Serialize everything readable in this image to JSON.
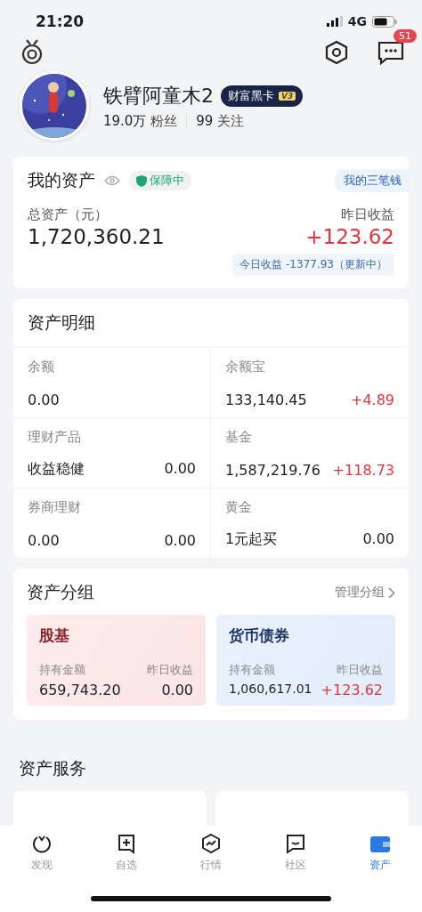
{
  "status_bar": {
    "time": "21:20",
    "network": "4G"
  },
  "header": {
    "message_badge": "51"
  },
  "profile": {
    "name": "铁臂阿童木2",
    "badge": "财富黑卡",
    "badge_level": "V3",
    "followers": "19.0万",
    "followers_label": "粉丝",
    "following": "99",
    "following_label": "关注"
  },
  "my_assets": {
    "title": "我的资产",
    "protection": "保障中",
    "link": "我的三笔钱",
    "total_label": "总资产（元）",
    "total": "1,720,360.21",
    "yesterday_label": "昨日收益",
    "yesterday": "+123.62",
    "today_note": "今日收益 -1377.93（更新中）"
  },
  "detail": {
    "title": "资产明细",
    "cells": [
      {
        "label": "余额",
        "main": "0.00"
      },
      {
        "label": "余额宝",
        "main": "133,140.45",
        "side": {
          "text": "+4.89",
          "kind": "gain"
        }
      },
      {
        "label": "理财产品",
        "main": "收益稳健",
        "side": {
          "text": "0.00",
          "kind": "plain"
        }
      },
      {
        "label": "基金",
        "main": "1,587,219.76",
        "side": {
          "text": "+118.73",
          "kind": "gain"
        }
      },
      {
        "label": "券商理财",
        "main": "0.00",
        "side": {
          "text": "0.00",
          "kind": "plain"
        }
      },
      {
        "label": "黄金",
        "main": "1元起买",
        "side": {
          "text": "0.00",
          "kind": "plain"
        }
      }
    ]
  },
  "groups": {
    "title": "资产分组",
    "manage": "管理分组",
    "cards": [
      {
        "kind": "stock",
        "name": "股基",
        "held_label": "持有金额",
        "held": "659,743.20",
        "yesterday_label": "昨日收益",
        "yesterday": {
          "text": "0.00",
          "kind": "plain"
        }
      },
      {
        "kind": "money",
        "name": "货币债券",
        "held_label": "持有金额",
        "held": "1,060,617.01",
        "yesterday_label": "昨日收益",
        "yesterday": {
          "text": "+123.62",
          "kind": "gain"
        }
      }
    ]
  },
  "services": {
    "title": "资产服务",
    "cards": [
      {
        "kind": "blank"
      },
      {
        "kind": "blank"
      }
    ]
  },
  "tabs": [
    {
      "label": "发现",
      "selected": false
    },
    {
      "label": "自选",
      "selected": false
    },
    {
      "label": "行情",
      "selected": false
    },
    {
      "label": "社区",
      "selected": false
    },
    {
      "label": "资产",
      "selected": true
    }
  ]
}
